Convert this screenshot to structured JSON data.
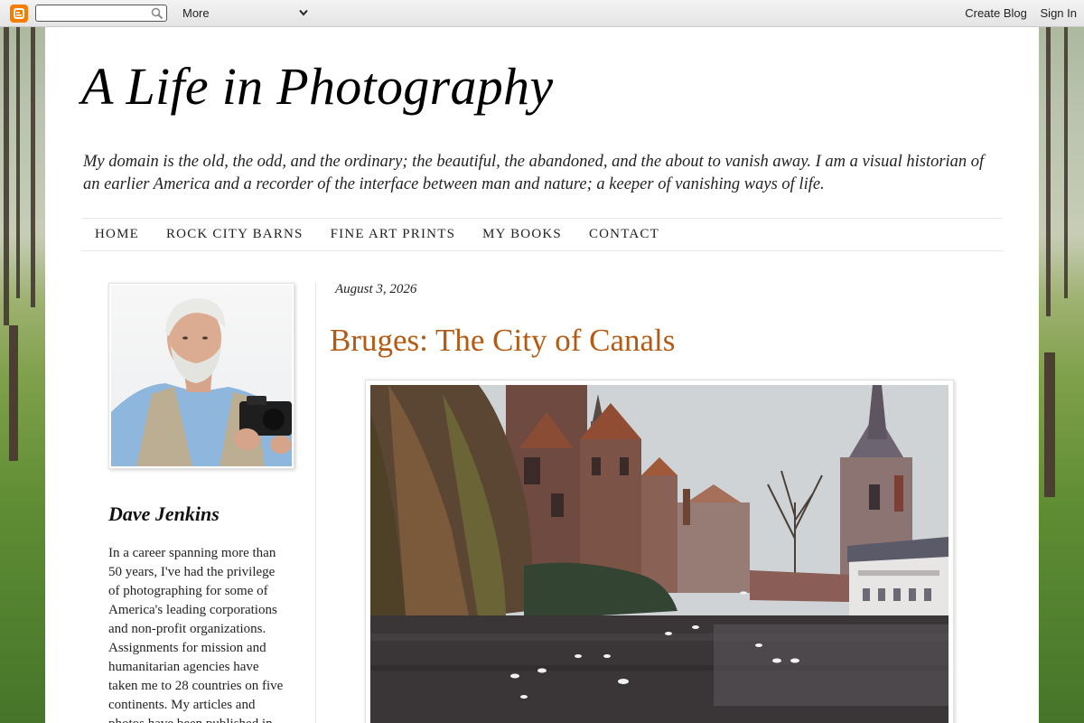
{
  "navbar": {
    "search_placeholder": "",
    "more_label": "More",
    "create_blog": "Create Blog",
    "sign_in": "Sign In"
  },
  "blog": {
    "title": "A Life in Photography",
    "description": "My domain is the old, the odd, and the ordinary; the beautiful, the abandoned, and the about to vanish away. I am a visual historian of an earlier America and a recorder of the interface between man and nature; a keeper of vanishing ways of life."
  },
  "tabs": [
    {
      "label": "HOME"
    },
    {
      "label": "ROCK CITY BARNS"
    },
    {
      "label": "FINE ART PRINTS"
    },
    {
      "label": "MY BOOKS"
    },
    {
      "label": "CONTACT"
    }
  ],
  "profile": {
    "name": "Dave Jenkins",
    "bio": "In a career spanning more than 50 years, I've had the privilege of photographing for some of America's leading corporations and non-profit organizations. Assignments for mission and humanitarian agencies have taken me to 28 countries on five continents. My articles and photos have been published in"
  },
  "post": {
    "date": "August 3, 2026",
    "title": "Bruges: The City of Canals"
  },
  "colors": {
    "post_title": "#b55a12",
    "blogger_orange": "#f57d00"
  },
  "icons": [
    "blogger-logo-icon",
    "search-icon",
    "chevron-down-icon"
  ]
}
